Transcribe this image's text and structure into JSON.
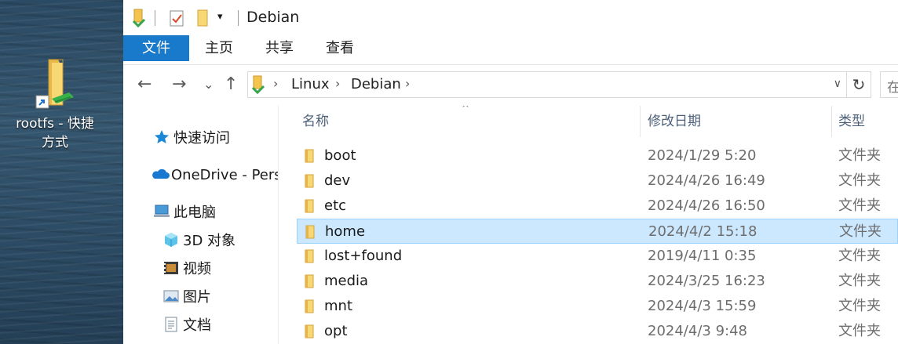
{
  "desktop": {
    "shortcut_label": "rootfs - 快捷方式",
    "shortcut_icon": "folder-shortcut-icon"
  },
  "window": {
    "title": "Debian",
    "quick_access_icons": [
      "folder-down-icon",
      "properties-check-icon",
      "new-folder-icon",
      "customize-dropdown-icon"
    ]
  },
  "ribbon": {
    "tabs": [
      "文件",
      "主页",
      "共享",
      "查看"
    ],
    "active_tab": "文件",
    "active_color": "#1979ca"
  },
  "address": {
    "back": "←",
    "forward": "→",
    "recent": "⌄",
    "up": "↑",
    "crumbs": [
      "Linux",
      "Debian"
    ],
    "crumb_sep": "›",
    "refresh": "↻",
    "search_placeholder": "在"
  },
  "nav": {
    "items": [
      {
        "label": "快速访问",
        "icon": "star-icon"
      },
      {
        "label": "OneDrive - Pers",
        "icon": "cloud-icon"
      },
      {
        "label": "此电脑",
        "icon": "computer-icon"
      },
      {
        "label": "3D 对象",
        "icon": "cube-3d-icon"
      },
      {
        "label": "视频",
        "icon": "video-icon"
      },
      {
        "label": "图片",
        "icon": "picture-icon"
      },
      {
        "label": "文档",
        "icon": "document-icon"
      }
    ]
  },
  "filelist": {
    "columns": {
      "name": "名称",
      "date": "修改日期",
      "type": "类型"
    },
    "sort_indicator": "^",
    "selected_row": "home",
    "rows": [
      {
        "name": "boot",
        "date": "2024/1/29 5:20",
        "type": "文件夹"
      },
      {
        "name": "dev",
        "date": "2024/4/26 16:49",
        "type": "文件夹"
      },
      {
        "name": "etc",
        "date": "2024/4/26 16:50",
        "type": "文件夹"
      },
      {
        "name": "home",
        "date": "2024/4/2 15:18",
        "type": "文件夹"
      },
      {
        "name": "lost+found",
        "date": "2019/4/11 0:35",
        "type": "文件夹"
      },
      {
        "name": "media",
        "date": "2024/3/25 16:23",
        "type": "文件夹"
      },
      {
        "name": "mnt",
        "date": "2024/4/3 15:59",
        "type": "文件夹"
      },
      {
        "name": "opt",
        "date": "2024/4/3 9:48",
        "type": "文件夹"
      }
    ]
  }
}
